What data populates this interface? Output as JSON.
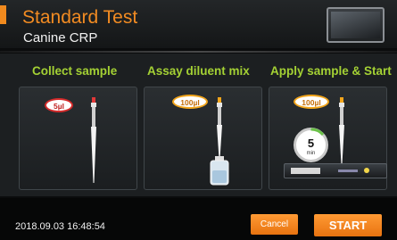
{
  "header": {
    "title": "Standard Test",
    "subtitle": "Canine CRP"
  },
  "steps": [
    {
      "label": "Collect sample",
      "volume": "5µl"
    },
    {
      "label": "Assay diluent mix",
      "volume": "100µl"
    },
    {
      "label": "Apply sample & Start",
      "volume": "100µl"
    }
  ],
  "timer": {
    "value": "5",
    "unit": "min"
  },
  "footer": {
    "datetime": "2018.09.03  16:48:54",
    "cancel_label": "Cancel",
    "start_label": "START"
  },
  "colors": {
    "accent": "#f18a1e",
    "step_label": "#a4d134",
    "red_badge": "#d42b2b",
    "orange_badge": "#f2a51b"
  },
  "icons": [
    "device-screen-icon",
    "pipette-icon",
    "vial-icon",
    "timer-icon",
    "test-cartridge-icon"
  ]
}
